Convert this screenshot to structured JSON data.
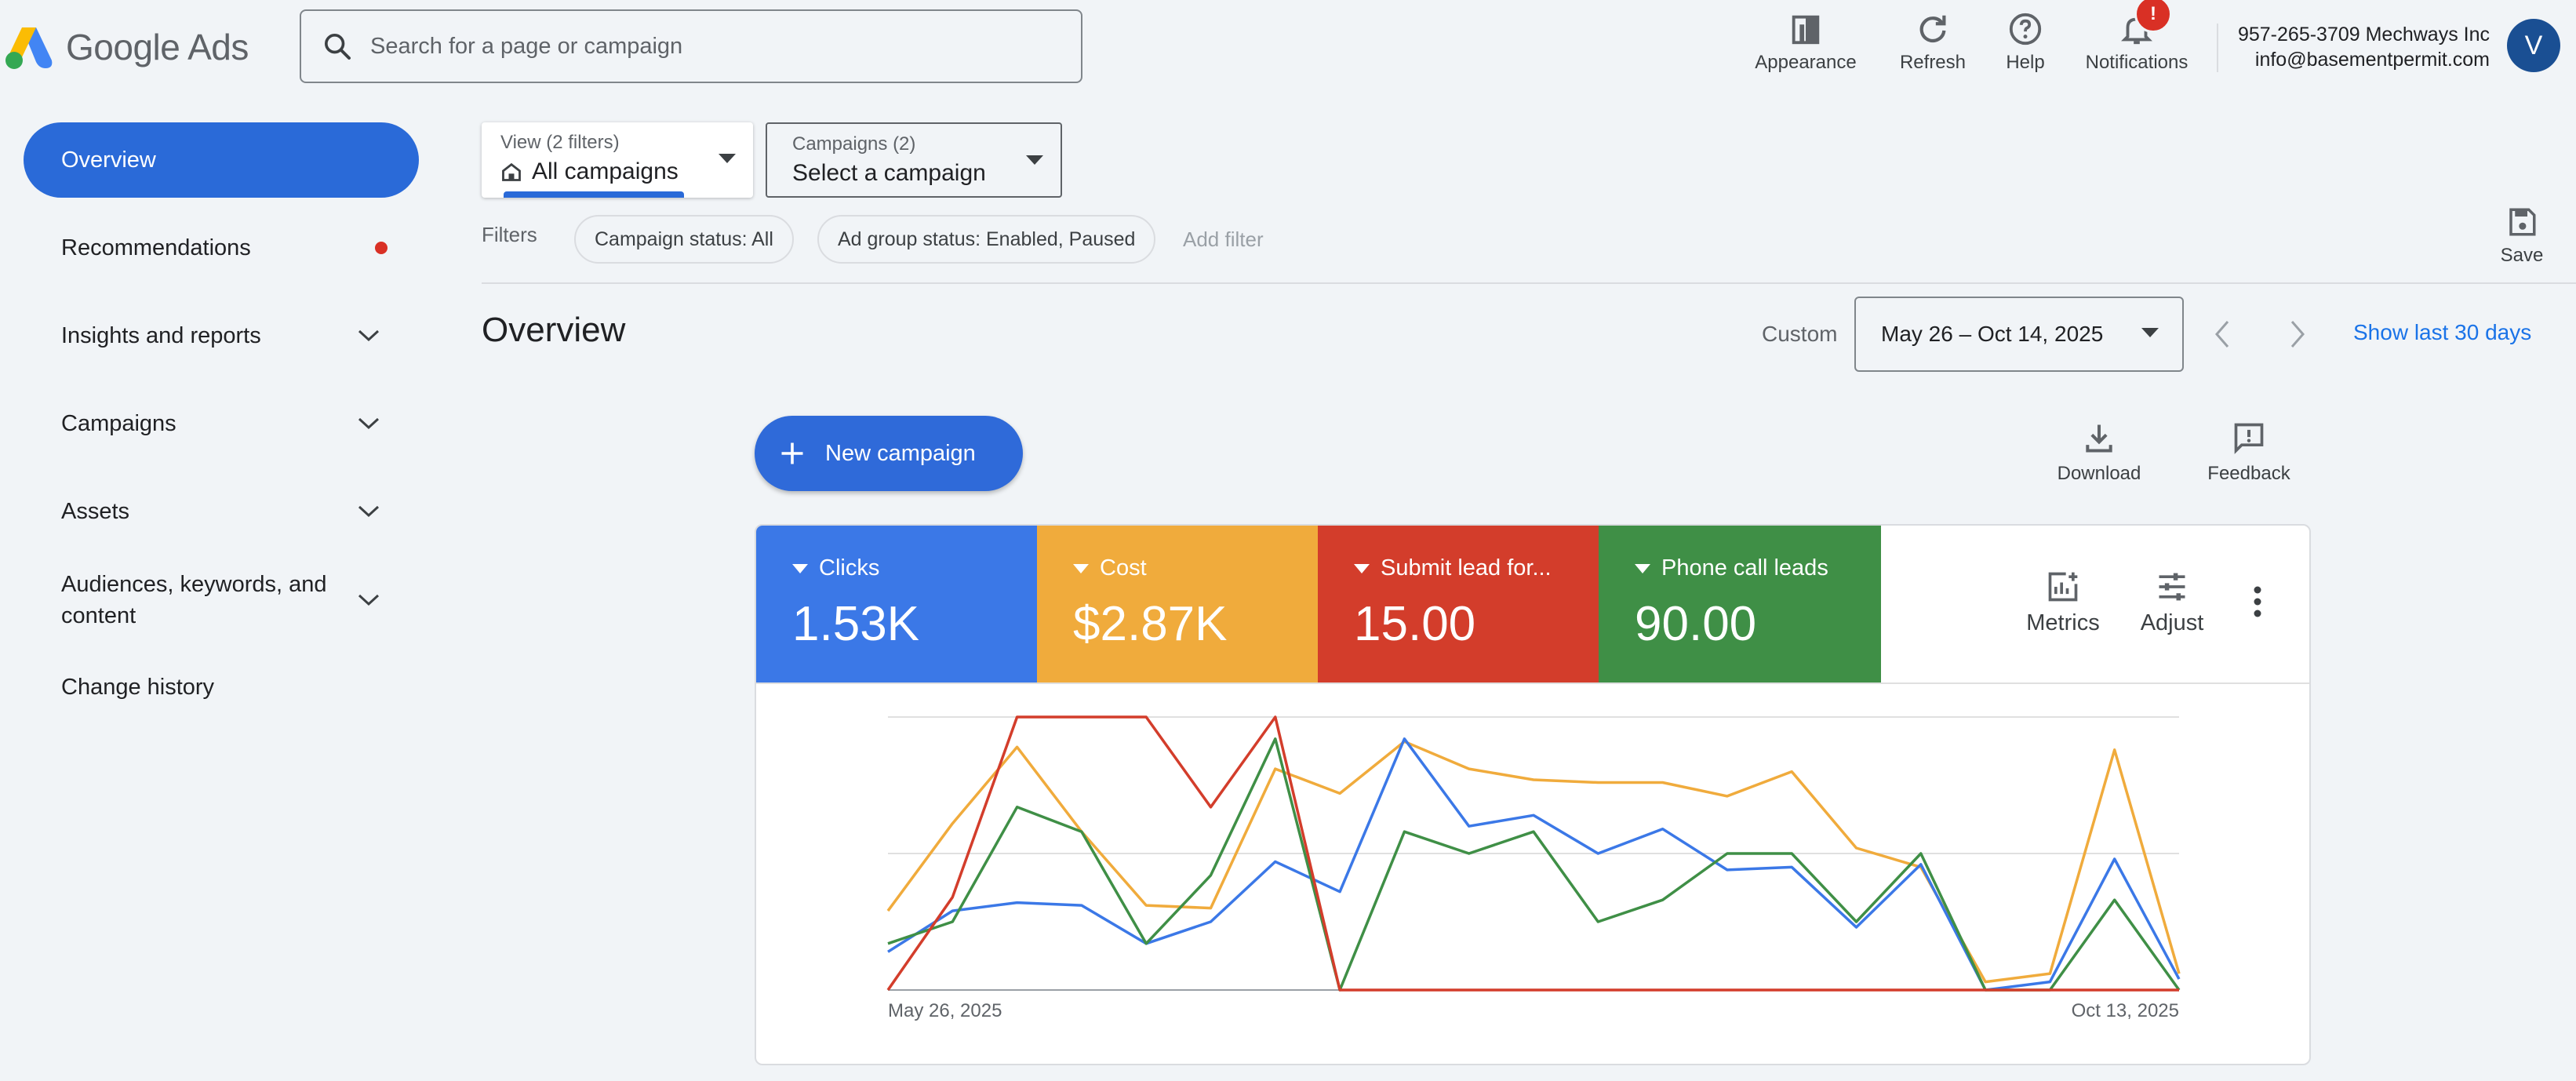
{
  "header": {
    "logo_text": "Google Ads",
    "search_placeholder": "Search for a page or campaign",
    "actions": [
      {
        "label": "Appearance",
        "icon": "appearance-icon"
      },
      {
        "label": "Refresh",
        "icon": "refresh-icon"
      },
      {
        "label": "Help",
        "icon": "help-icon"
      },
      {
        "label": "Notifications",
        "icon": "bell-icon",
        "badge": "!"
      }
    ],
    "account": {
      "line1": "957-265-3709 Mechways Inc",
      "line2": "info@basementpermit.com",
      "avatar_letter": "V"
    }
  },
  "sidebar": {
    "items": [
      {
        "label": "Overview",
        "active": true
      },
      {
        "label": "Recommendations",
        "has_dot": true
      },
      {
        "label": "Insights and reports",
        "expandable": true
      },
      {
        "label": "Campaigns",
        "expandable": true
      },
      {
        "label": "Assets",
        "expandable": true
      },
      {
        "label": "Audiences, keywords, and content",
        "expandable": true
      },
      {
        "label": "Change history"
      }
    ]
  },
  "filters": {
    "view_small": "View (2 filters)",
    "view_value": "All campaigns",
    "campaigns_small": "Campaigns (2)",
    "campaigns_value": "Select a campaign",
    "label": "Filters",
    "chips": [
      "Campaign status: All",
      "Ad group status: Enabled, Paused"
    ],
    "add_filter": "Add filter",
    "save_label": "Save"
  },
  "overview": {
    "title": "Overview",
    "custom_label": "Custom",
    "date_range": "May 26 – Oct 14, 2025",
    "show_last": "Show last 30 days",
    "new_campaign": "New campaign",
    "download": "Download",
    "feedback": "Feedback"
  },
  "metrics": {
    "tiles": [
      {
        "name": "Clicks",
        "value": "1.53K",
        "color": "#3b78e7"
      },
      {
        "name": "Cost",
        "value": "$2.87K",
        "color": "#f0ab3c"
      },
      {
        "name": "Submit lead for...",
        "value": "15.00",
        "color": "#d33d2b"
      },
      {
        "name": "Phone call leads",
        "value": "90.00",
        "color": "#3f8f46"
      }
    ],
    "metrics_label": "Metrics",
    "adjust_label": "Adjust"
  },
  "chart_data": {
    "type": "line",
    "x_start_label": "May 26, 2025",
    "x_end_label": "Oct 13, 2025",
    "grid": true,
    "series": [
      {
        "name": "Clicks",
        "color": "#3b78e7",
        "values": [
          0.14,
          0.29,
          0.32,
          0.31,
          0.17,
          0.25,
          0.47,
          0.36,
          0.92,
          0.6,
          0.64,
          0.5,
          0.59,
          0.44,
          0.45,
          0.23,
          0.46,
          0.0,
          0.03,
          0.48,
          0.04
        ]
      },
      {
        "name": "Cost",
        "color": "#f0ab3c",
        "values": [
          0.29,
          0.61,
          0.89,
          0.58,
          0.31,
          0.3,
          0.81,
          0.72,
          0.91,
          0.81,
          0.77,
          0.76,
          0.76,
          0.71,
          0.8,
          0.52,
          0.45,
          0.03,
          0.06,
          0.88,
          0.06
        ]
      },
      {
        "name": "Submit lead for...",
        "color": "#d33d2b",
        "values": [
          0.0,
          0.34,
          1.0,
          1.0,
          1.0,
          0.67,
          1.0,
          0.0,
          0.0,
          0.0,
          0.0,
          0.0,
          0.0,
          0.0,
          0.0,
          0.0,
          0.0,
          0.0,
          0.0,
          0.0,
          0.0
        ]
      },
      {
        "name": "Phone call leads",
        "color": "#3f8f46",
        "values": [
          0.17,
          0.25,
          0.67,
          0.58,
          0.17,
          0.42,
          0.92,
          0.0,
          0.58,
          0.5,
          0.58,
          0.25,
          0.33,
          0.5,
          0.5,
          0.25,
          0.5,
          0.0,
          0.0,
          0.33,
          0.0
        ]
      }
    ]
  }
}
